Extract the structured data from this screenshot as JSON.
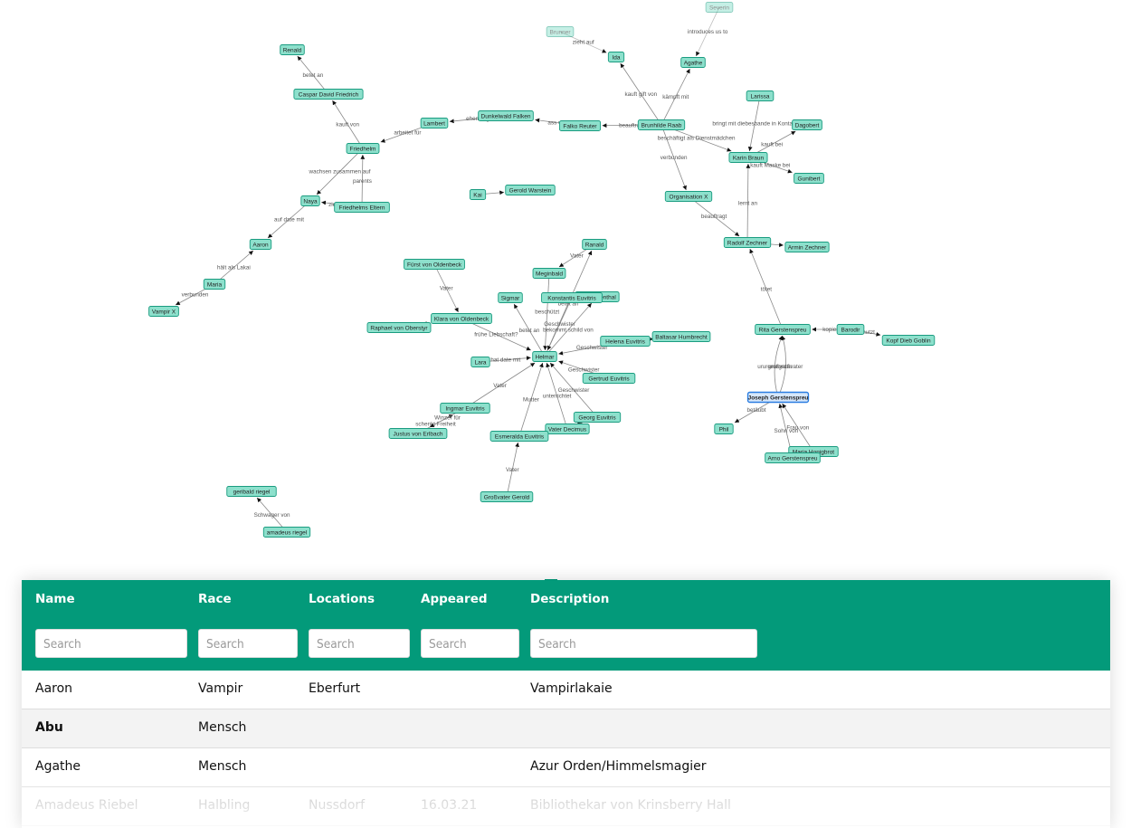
{
  "graph": {
    "node_color": "#8de0cc",
    "node_border": "#1a9c80",
    "selected_color": "#d6e7fb",
    "selected_border": "#2a7de1",
    "selected": "Joseph Gerstenspreu",
    "faded": [
      "Brunner",
      "Severin"
    ],
    "nodes": [
      "Renald",
      "Caspar David Friedrich",
      "Friedhelm",
      "Lambert",
      "Dunkelwald Falken",
      "Falko Reuter",
      "Brunhilde Raab",
      "Ida",
      "Brunner",
      "Agathe",
      "Severin",
      "Larissa",
      "Dagobert",
      "Karin Braun",
      "Gunibert",
      "Organisation X",
      "Radolf Zechner",
      "Armin Zechner",
      "Naya",
      "Friedhelms Eltern",
      "Aaron",
      "Maria",
      "Vampir X",
      "Kai",
      "Gerold Warstein",
      "Fürst von Oldenbeck",
      "Klara von Oldenbeck",
      "Raphael von Oberstyr",
      "Ranald",
      "Meginbald",
      "Sigmar",
      "von Rosenthal",
      "Konstantis Euvitris",
      "Helmar",
      "Lara",
      "Baltasar Humbrecht",
      "Helena Euvitris",
      "Gertrud Euvitris",
      "Georg Euvitris",
      "Vater Decimus",
      "Ingmar Euvitris",
      "Justus von Erlbach",
      "Esmeralda Euvitris",
      "Großvater Gerold",
      "Rita Gerstenspreu",
      "Barodir",
      "Kopf Dieb Goblin",
      "Joseph Gerstenspreu",
      "Phil",
      "Maria Honigbrot",
      "Arno Gerstenspreu",
      "geribald riegel",
      "amadeus riegel"
    ],
    "edges": [
      [
        "Caspar David Friedrich",
        "Renald",
        "betet an"
      ],
      [
        "Friedhelm",
        "Caspar David Friedrich",
        "kauft von"
      ],
      [
        "Lambert",
        "Friedhelm",
        "arbeitet für"
      ],
      [
        "Dunkelwald Falken",
        "Lambert",
        "ehemalig"
      ],
      [
        "Falko Reuter",
        "Dunkelwald Falken",
        "ass von"
      ],
      [
        "Brunhilde Raab",
        "Falko Reuter",
        "beauftragt"
      ],
      [
        "Brunhilde Raab",
        "Ida",
        "kauft gift von"
      ],
      [
        "Brunner",
        "Ida",
        "zieht auf"
      ],
      [
        "Severin",
        "Agathe",
        "introduces us to"
      ],
      [
        "Brunhilde Raab",
        "Agathe",
        "kämpft mit"
      ],
      [
        "Brunhilde Raab",
        "Karin Braun",
        "beschäftigt als Dienstmädchen"
      ],
      [
        "Larissa",
        "Karin Braun",
        "bringt mit diebesbande in Kontakt"
      ],
      [
        "Karin Braun",
        "Dagobert",
        "kauft bei"
      ],
      [
        "Karin Braun",
        "Gunibert",
        "kauft Maske bei"
      ],
      [
        "Brunhilde Raab",
        "Organisation X",
        "verbunden"
      ],
      [
        "Organisation X",
        "Radolf Zechner",
        "beauftragt"
      ],
      [
        "Radolf Zechner",
        "Karin Braun",
        "lernt an"
      ],
      [
        "Radolf Zechner",
        "Armin Zechner",
        ""
      ],
      [
        "Rita Gerstenspreu",
        "Radolf Zechner",
        "tötet"
      ],
      [
        "Friedhelm",
        "Naya",
        "wachsen zusammen auf"
      ],
      [
        "Friedhelms Eltern",
        "Friedhelm",
        "parents"
      ],
      [
        "Friedhelms Eltern",
        "Naya",
        "ziehen auf"
      ],
      [
        "Naya",
        "Aaron",
        "auf date mit"
      ],
      [
        "Maria",
        "Aaron",
        "hält als Lakai"
      ],
      [
        "Maria",
        "Vampir X",
        "verbunden"
      ],
      [
        "Kai",
        "Gerold Warstein",
        ""
      ],
      [
        "Fürst von Oldenbeck",
        "Klara von Oldenbeck",
        "Vater"
      ],
      [
        "Klara von Oldenbeck",
        "Helmar",
        "frühe Liebschaft?"
      ],
      [
        "Raphael von Oberstyr",
        "Klara von Oldenbeck",
        ""
      ],
      [
        "Ranald",
        "Meginbald",
        "Vater"
      ],
      [
        "Helmar",
        "Ranald",
        "betet an"
      ],
      [
        "Meginbald",
        "Helmar",
        "beschützt"
      ],
      [
        "Helmar",
        "Sigmar",
        "betet an"
      ],
      [
        "Konstantis Euvitris",
        "Helmar",
        "Geschwister"
      ],
      [
        "Helmar",
        "von Rosenthal",
        "bekommt schild von"
      ],
      [
        "Lara",
        "Helmar",
        "hat date mit"
      ],
      [
        "Helena Euvitris",
        "Helmar",
        "Geschwister"
      ],
      [
        "Helena Euvitris",
        "Baltasar Humbrecht",
        ""
      ],
      [
        "Gertrud Euvitris",
        "Helmar",
        "Geschwister"
      ],
      [
        "Georg Euvitris",
        "Helmar",
        "Geschwister"
      ],
      [
        "Vater Decimus",
        "Helmar",
        "unterrichtet"
      ],
      [
        "Vater Decimus",
        "Georg Euvitris",
        "unterrichtet"
      ],
      [
        "Ingmar Euvitris",
        "Helmar",
        "Vater"
      ],
      [
        "Esmeralda Euvitris",
        "Helmar",
        "Mutter"
      ],
      [
        "Großvater Gerold",
        "Esmeralda Euvitris",
        "Vater"
      ],
      [
        "Justus von Erlbach",
        "Ingmar Euvitris",
        "schenkt Freiheit"
      ],
      [
        "Ingmar Euvitris",
        "Justus von Erlbach",
        "Winzer für"
      ],
      [
        "Joseph Gerstenspreu",
        "Rita Gerstenspreu",
        "ururgroßvater"
      ],
      [
        "Joseph Gerstenspreu",
        "Rita Gerstenspreu",
        "ururgroßvater"
      ],
      [
        "Barodir",
        "Rita Gerstenspreu",
        "kopiert"
      ],
      [
        "Barodir",
        "Kopf Dieb Goblin",
        "benutzt"
      ],
      [
        "Joseph Gerstenspreu",
        "Phil",
        "betäubt"
      ],
      [
        "Maria Honigbrot",
        "Joseph Gerstenspreu",
        "Frau von"
      ],
      [
        "Arno Gerstenspreu",
        "Joseph Gerstenspreu",
        "Sohn von"
      ],
      [
        "Arno Gerstenspreu",
        "Maria Honigbrot",
        "Sohn von"
      ],
      [
        "amadeus riegel",
        "geribald riegel",
        "Schwager von"
      ]
    ]
  },
  "table": {
    "accent": "#039a7a",
    "columns": [
      "Name",
      "Race",
      "Locations",
      "Appeared",
      "Description"
    ],
    "search_placeholder": "Search",
    "rows": [
      {
        "name": "Aaron",
        "race": "Vampir",
        "locations": "Eberfurt",
        "appeared": "",
        "description": "Vampirlakaie"
      },
      {
        "name": "Abu",
        "race": "Mensch",
        "locations": "",
        "appeared": "",
        "description": ""
      },
      {
        "name": "Agathe",
        "race": "Mensch",
        "locations": "",
        "appeared": "",
        "description": "Azur Orden/Himmelsmagier"
      },
      {
        "name": "Amadeus Riebel",
        "race": "Halbling",
        "locations": "Nussdorf",
        "appeared": "16.03.21",
        "description": "Bibliothekar von Krinsberry Hall"
      }
    ]
  }
}
